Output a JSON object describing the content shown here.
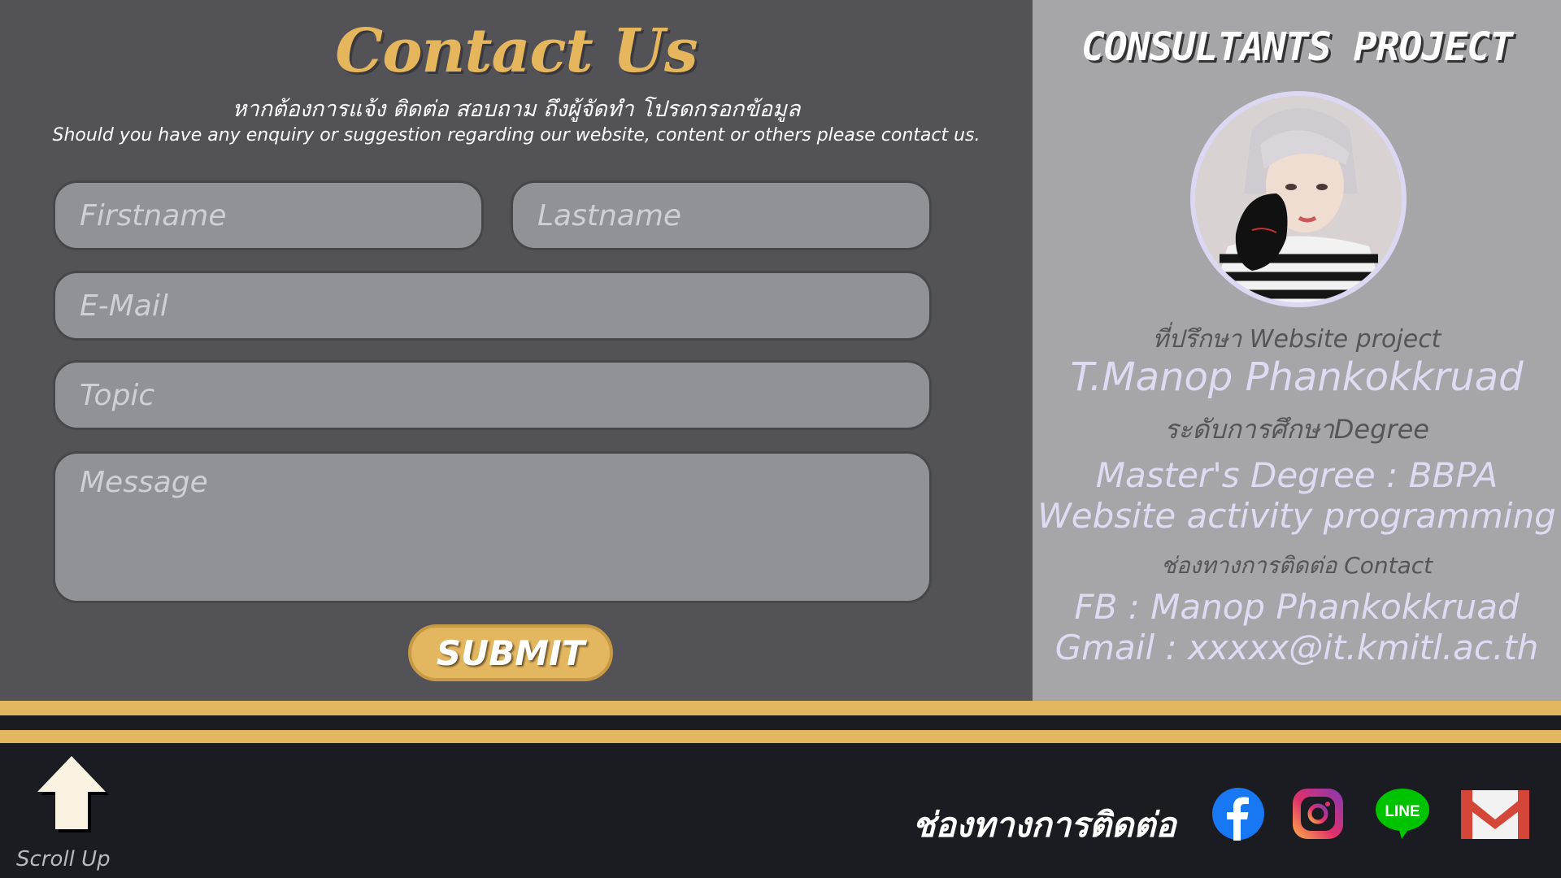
{
  "contact": {
    "title": "Contact Us",
    "subtitle_th": "หากต้องการแจ้ง ติดต่อ สอบถาม ถึงผู้จัดทำ โปรดกรอกข้อมูล",
    "subtitle_en": "Should you have any enquiry or suggestion regarding our website, content or others please contact us.",
    "form": {
      "firstname_placeholder": "Firstname",
      "lastname_placeholder": "Lastname",
      "email_placeholder": "E-Mail",
      "topic_placeholder": "Topic",
      "message_placeholder": "Message",
      "submit_label": "SUBMIT"
    }
  },
  "consultant": {
    "title": "CONSULTANTS PROJECT",
    "role": "ที่ปรึกษา Website project",
    "name": "T.Manop Phankokkruad",
    "degree_label": "ระดับการศึกษาDegree",
    "degree": "Master's Degree : BBPA",
    "program": "Website activity programming",
    "contact_label": "ช่องทางการติดต่อ Contact",
    "facebook": "FB : Manop Phankokkruad",
    "gmail": "Gmail : xxxxx@it.kmitl.ac.th"
  },
  "footer": {
    "scroll_up_label": "Scroll Up",
    "contact_label": "ช่องทางการติดต่อ",
    "social": [
      {
        "icon": "facebook-icon",
        "color": "#1877f2"
      },
      {
        "icon": "instagram-icon",
        "color": "#c13584"
      },
      {
        "icon": "line-icon",
        "color": "#00c300",
        "text": "LINE"
      },
      {
        "icon": "gmail-icon",
        "color": "#d44638"
      }
    ]
  },
  "colors": {
    "accent_gold": "#e3b660",
    "panel_dark": "#525257",
    "panel_light": "#a6a6a9",
    "footer_bg": "#1b1b22",
    "lavender_text": "#dedbf3"
  }
}
